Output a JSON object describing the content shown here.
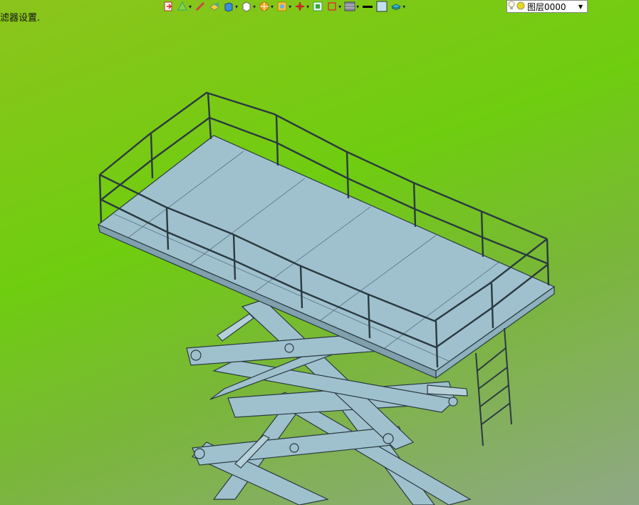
{
  "status": {
    "text": "滤器设置."
  },
  "toolbar": {
    "icons": [
      "import-icon",
      "shape-icon",
      "pen-icon",
      "cube-yellow-icon",
      "cube-blue-icon",
      "cube-white-icon",
      "sphere-icon",
      "photo-icon",
      "axis-icon",
      "frame-icon",
      "dimension-icon",
      "grid-icon",
      "line-icon",
      "color-swatch-icon",
      "layers-icon"
    ]
  },
  "layer": {
    "name": "图层0000"
  },
  "colors": {
    "bg_top": "#6fcd10",
    "bg_bottom": "#8fa886",
    "model_fill": "#9fc1ce",
    "model_edge": "#2a3a40"
  }
}
